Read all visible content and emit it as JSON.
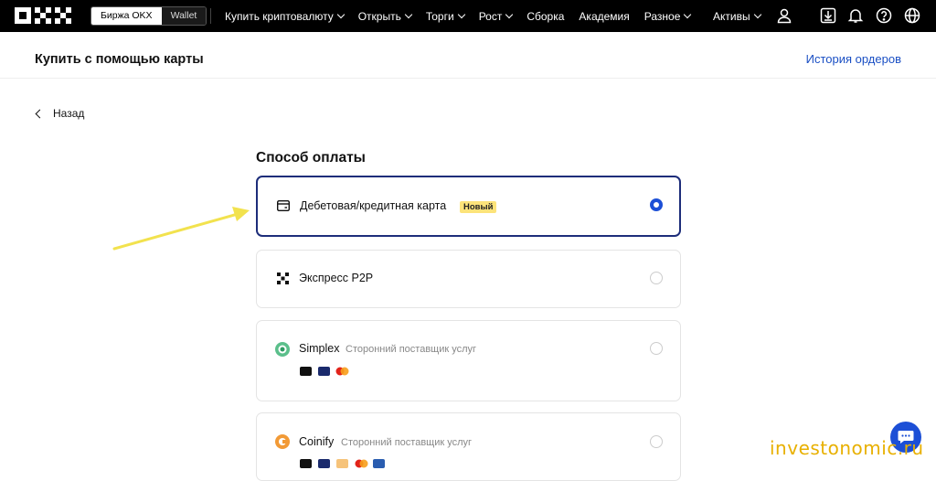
{
  "topbar": {
    "exchange_tab": "Биржа OKX",
    "wallet_tab": "Wallet",
    "nav": [
      {
        "label": "Купить криптовалюту",
        "has_dropdown": true
      },
      {
        "label": "Открыть",
        "has_dropdown": true
      },
      {
        "label": "Торги",
        "has_dropdown": true
      },
      {
        "label": "Рост",
        "has_dropdown": true
      },
      {
        "label": "Сборка",
        "has_dropdown": false
      },
      {
        "label": "Академия",
        "has_dropdown": false
      },
      {
        "label": "Разное",
        "has_dropdown": true
      }
    ],
    "assets_label": "Активы",
    "icons": [
      "user-icon",
      "download-icon",
      "bell-icon",
      "help-icon",
      "globe-icon"
    ]
  },
  "header": {
    "title": "Купить с помощью карты",
    "history_link": "История ордеров"
  },
  "back_label": "Назад",
  "payment": {
    "section_title": "Способ оплаты",
    "methods": [
      {
        "name": "Дебетовая/кредитная карта",
        "badge": "Новый",
        "subtitle": "",
        "selected": true,
        "icon": "card-icon"
      },
      {
        "name": "Экспресс P2P",
        "badge": "",
        "subtitle": "",
        "selected": false,
        "icon": "p2p-icon"
      },
      {
        "name": "Simplex",
        "badge": "",
        "subtitle": "Сторонний поставщик услуг",
        "selected": false,
        "icon": "simplex-icon",
        "pay_icons": [
          "apple-pay-icon",
          "visa-icon",
          "mastercard-icon"
        ]
      },
      {
        "name": "Coinify",
        "badge": "",
        "subtitle": "Сторонний поставщик услуг",
        "selected": false,
        "icon": "coinify-icon",
        "pay_icons": [
          "apple-pay-icon",
          "visa-icon",
          "bank-card-icon",
          "mastercard-icon",
          "sepa-icon"
        ]
      }
    ]
  },
  "watermark": "investonomic.ru",
  "colors": {
    "accent": "#1c4fd6",
    "selected_border": "#1d2d7a",
    "badge_bg": "#fce37a",
    "annotation_arrow": "#f2e24e"
  }
}
